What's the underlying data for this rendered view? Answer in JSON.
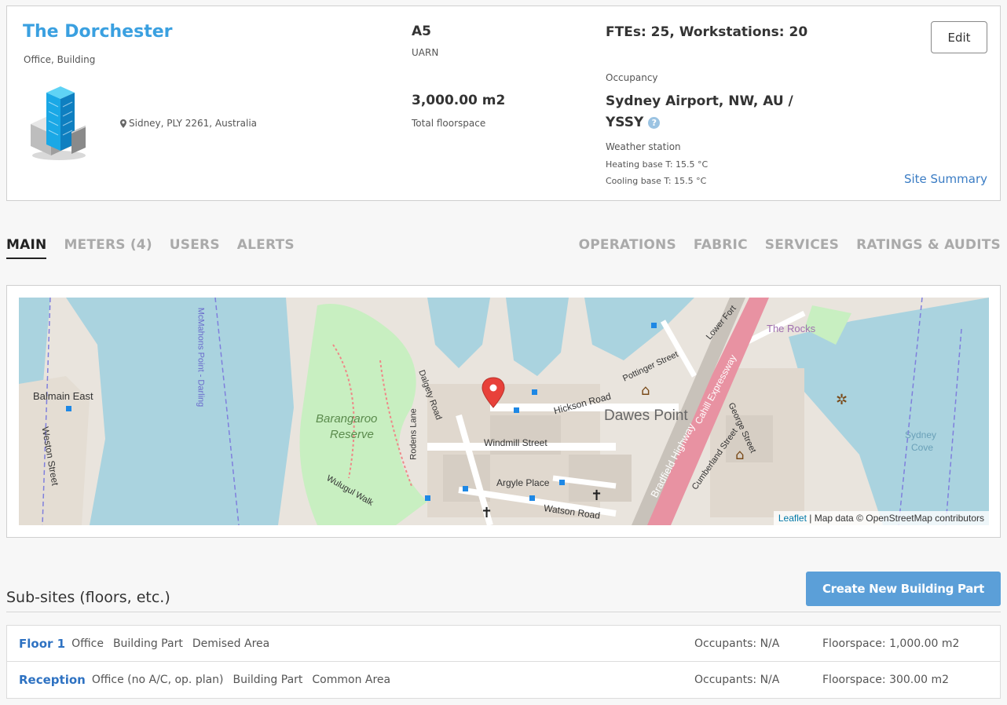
{
  "site": {
    "name": "The Dorchester",
    "type": "Office, Building",
    "location": "Sidney, PLY 2261, Australia",
    "uarn_value": "A5",
    "uarn_label": "UARN",
    "floorspace_value": "3,000.00 m2",
    "floorspace_label": "Total floorspace",
    "occupancy_value": "FTEs: 25, Workstations: 20",
    "occupancy_label": "Occupancy",
    "weather_station_value": "Sydney Airport, NW, AU / YSSY",
    "weather_station_label": "Weather station",
    "heating_base": "Heating base T: 15.5 °C",
    "cooling_base": "Cooling base T: 15.5 °C",
    "edit_label": "Edit",
    "summary_link": "Site Summary",
    "help_icon": "?"
  },
  "tabs": {
    "left": [
      {
        "label": "MAIN",
        "active": true
      },
      {
        "label": "METERS (4)",
        "active": false
      },
      {
        "label": "USERS",
        "active": false
      },
      {
        "label": "ALERTS",
        "active": false
      }
    ],
    "right": [
      {
        "label": "OPERATIONS"
      },
      {
        "label": "FABRIC"
      },
      {
        "label": "SERVICES"
      },
      {
        "label": "RATINGS & AUDITS"
      }
    ]
  },
  "map": {
    "labels": {
      "balmain": "Balmain East",
      "barangaroo_1": "Barangaroo",
      "barangaroo_2": "Reserve",
      "dawes": "Dawes Point",
      "windmill": "Windmill Street",
      "argyle": "Argyle Place",
      "hickson": "Hickson Road",
      "bradfield": "Bradfield Highway",
      "cahill": "Cahill Expressway",
      "rocks": "The Rocks",
      "sydney_cove_1": "Sydney",
      "sydney_cove_2": "Cove",
      "watson": "Watson Road",
      "weston": "Weston Street",
      "mcmahons": "McMahons Point - Darling",
      "george": "George Street",
      "cumberland": "Cumberland Street",
      "lower_fort": "Lower Fort",
      "pottinger": "Pottinger Street",
      "wulugul": "Wulugul Walk",
      "dalgety": "Dalgety Road",
      "rodens": "Rodens Lane"
    },
    "attribution_link": "Leaflet",
    "attribution_text": "| Map data © OpenStreetMap contributors"
  },
  "subsites": {
    "title": "Sub-sites (floors, etc.)",
    "create_label": "Create New Building Part",
    "rows": [
      {
        "name": "Floor 1",
        "tags": [
          "Office",
          "Building Part",
          "Demised Area"
        ],
        "occupants": "Occupants: N/A",
        "floorspace": "Floorspace: 1,000.00 m2"
      },
      {
        "name": "Reception",
        "tags": [
          "Office (no A/C, op. plan)",
          "Building Part",
          "Common Area"
        ],
        "occupants": "Occupants: N/A",
        "floorspace": "Floorspace: 300.00 m2"
      }
    ]
  },
  "colors": {
    "accent": "#3aa0e0",
    "link": "#3a7cc4",
    "button": "#5b9fd8",
    "water": "#aad3df",
    "park": "#c8efc1",
    "highway": "#e892a2",
    "marker": "#e8413a"
  }
}
